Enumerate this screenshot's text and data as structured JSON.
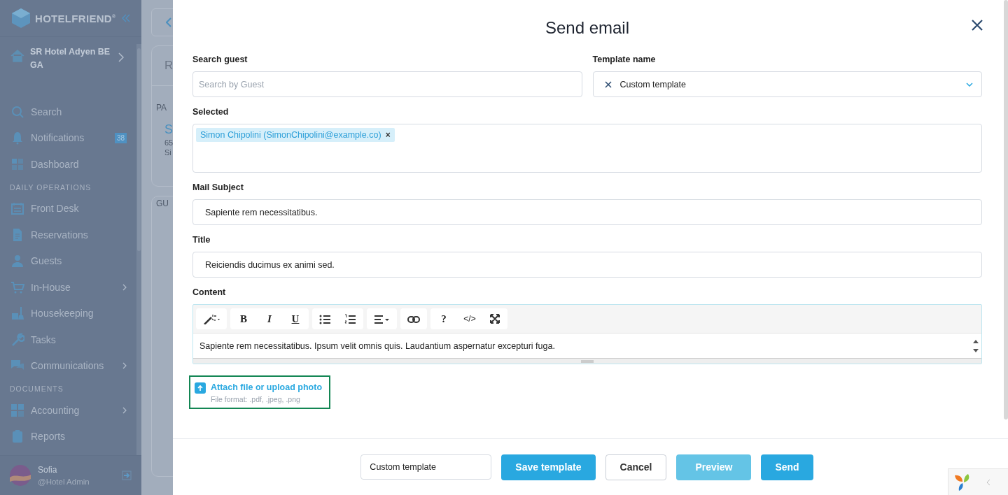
{
  "sidebar": {
    "brand": "HOTELFRIEND",
    "brand_mark": "®",
    "hotel": "SR Hotel Adyen BE GA",
    "items": [
      {
        "kind": "item",
        "label": "Search",
        "expandable": false
      },
      {
        "kind": "item",
        "label": "Notifications",
        "expandable": false,
        "badge": "38"
      },
      {
        "kind": "item",
        "label": "Dashboard",
        "expandable": false
      },
      {
        "kind": "section",
        "label": "DAILY OPERATIONS"
      },
      {
        "kind": "item",
        "label": "Front Desk",
        "expandable": false
      },
      {
        "kind": "item",
        "label": "Reservations",
        "expandable": false
      },
      {
        "kind": "item",
        "label": "Guests",
        "expandable": false
      },
      {
        "kind": "item",
        "label": "In-House",
        "expandable": true
      },
      {
        "kind": "item",
        "label": "Housekeeping",
        "expandable": false
      },
      {
        "kind": "item",
        "label": "Tasks",
        "expandable": false
      },
      {
        "kind": "item",
        "label": "Communications",
        "expandable": true
      },
      {
        "kind": "section",
        "label": "DOCUMENTS"
      },
      {
        "kind": "item",
        "label": "Accounting",
        "expandable": true
      },
      {
        "kind": "item",
        "label": "Reports",
        "expandable": false
      }
    ],
    "user": {
      "name": "Sofia",
      "role": "@Hotel Admin"
    }
  },
  "background_page": {
    "card_title": "R",
    "label": "PA",
    "name": "S",
    "line_1": "65",
    "line_2": "Si",
    "section": "GU"
  },
  "modal": {
    "title": "Send email",
    "search_guest": {
      "label": "Search guest",
      "placeholder": "Search by Guest"
    },
    "template_name": {
      "label": "Template name",
      "value": "Custom template"
    },
    "selected": {
      "label": "Selected",
      "chips": [
        {
          "text": "Simon Chipolini (SimonChipolini@example.co)",
          "remove": "×"
        }
      ]
    },
    "mail_subject": {
      "label": "Mail Subject",
      "value": "Sapiente rem necessitatibus."
    },
    "title_field": {
      "label": "Title",
      "value": "Reiciendis ducimus ex animi sed."
    },
    "content": {
      "label": "Content",
      "toolbar": [
        [
          {
            "kind": "magic"
          }
        ],
        [
          {
            "kind": "bold",
            "label": "B"
          },
          {
            "kind": "italic",
            "label": "I"
          },
          {
            "kind": "underline",
            "label": "U"
          }
        ],
        [
          {
            "kind": "ul"
          },
          {
            "kind": "ol"
          }
        ],
        [
          {
            "kind": "align"
          }
        ],
        [
          {
            "kind": "link"
          }
        ],
        [
          {
            "kind": "help",
            "label": "?"
          },
          {
            "kind": "code",
            "label": "</>"
          },
          {
            "kind": "fullscreen"
          }
        ]
      ],
      "text": "Sapiente rem necessitatibus. Ipsum velit omnis quis. Laudantium aspernatur excepturi fuga."
    },
    "attach": {
      "label": "Attach file or upload photo",
      "hint": "File format: .pdf, .jpeg, .png"
    },
    "footer": {
      "template_input": "Custom template",
      "buttons": [
        {
          "label": "Save template",
          "kind": "primary"
        },
        {
          "label": "Cancel",
          "kind": "outline"
        },
        {
          "label": "Preview",
          "kind": "light"
        },
        {
          "label": "Send",
          "kind": "primary"
        }
      ]
    }
  }
}
